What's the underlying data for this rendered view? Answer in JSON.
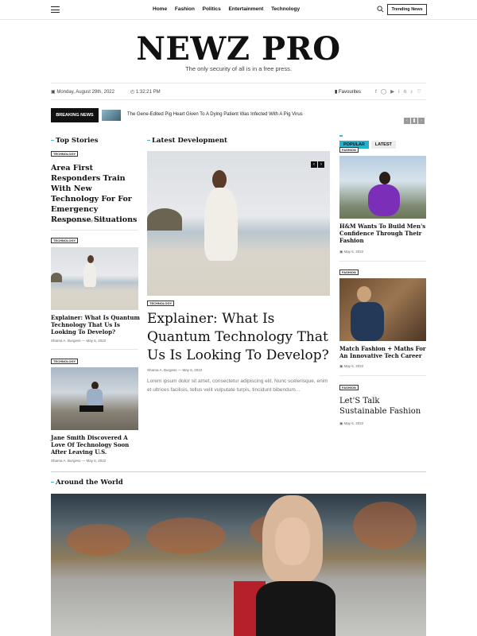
{
  "nav": {
    "menu": [
      "Home",
      "Fashion",
      "Politics",
      "Entertainment",
      "Technology"
    ],
    "trending_label": "Trending News"
  },
  "brand": {
    "logo": "NEWZ PRO",
    "tagline": "The only security of all is in a free press."
  },
  "meta": {
    "date": "Monday, August 29th, 2022",
    "time": "1:32:21 PM",
    "favourites": "Favourites",
    "social_icons": [
      "facebook-icon",
      "instagram-icon",
      "youtube-icon",
      "linkedin-icon",
      "tiktok-icon",
      "snapchat-icon"
    ]
  },
  "breaking": {
    "label": "BREAKING NEWS",
    "headline": "The Gene-Edited Pig Heart Given To A Dying Patient Was Infected With A Pig Virus"
  },
  "top_stories": {
    "heading": "Top Stories",
    "items": [
      {
        "tag": "TECHNOLOGY",
        "title": "Area First Responders Train With New Technology For For Emergency Response Situations",
        "author": "Sharna A. Burgess",
        "date": "May 6, 2022"
      },
      {
        "tag": "TECHNOLOGY",
        "title": "Explainer: What Is Quantum Technology That Us Is Looking To Develop?",
        "author": "Sharna A. Burgess",
        "date": "May 6, 2022"
      },
      {
        "tag": "TECHNOLOGY",
        "title": "Jane Smith Discovered A Love Of Technology Soon After Leaving U.S.",
        "author": "Sharna A. Burgess",
        "date": "May 6, 2022"
      }
    ]
  },
  "latest_development": {
    "heading": "Latest Development",
    "tag": "TECHNOLOGY",
    "title": "Explainer: What Is Quantum Technology That Us Is Looking To Develop?",
    "author": "Sharna A. Burgess",
    "date": "May 6, 2022",
    "excerpt": "Lorem ipsum dolor sit amet, consectetur adipiscing elit. Nunc scelerisque, enim et ultrices facilisis, tellus velit vulputate turpis, tincidunt bibendum..."
  },
  "sidebar": {
    "tabs": [
      "POPULAR",
      "LATEST"
    ],
    "items": [
      {
        "tag": "FASHION",
        "title": "H&M Wants To Build Men's Confidence Through Their Fashion",
        "date": "May 6, 2022"
      },
      {
        "tag": "FASHION",
        "title": "Match Fashion + Maths For An Innovative Tech Career",
        "date": "May 6, 2022"
      },
      {
        "tag": "FASHION",
        "title": "Let'S Talk Sustainable Fashion",
        "date": "May 6, 2022"
      }
    ]
  },
  "around": {
    "heading": "Around the World"
  },
  "colors": {
    "accent": "#1fb3d1",
    "dark": "#111111"
  }
}
